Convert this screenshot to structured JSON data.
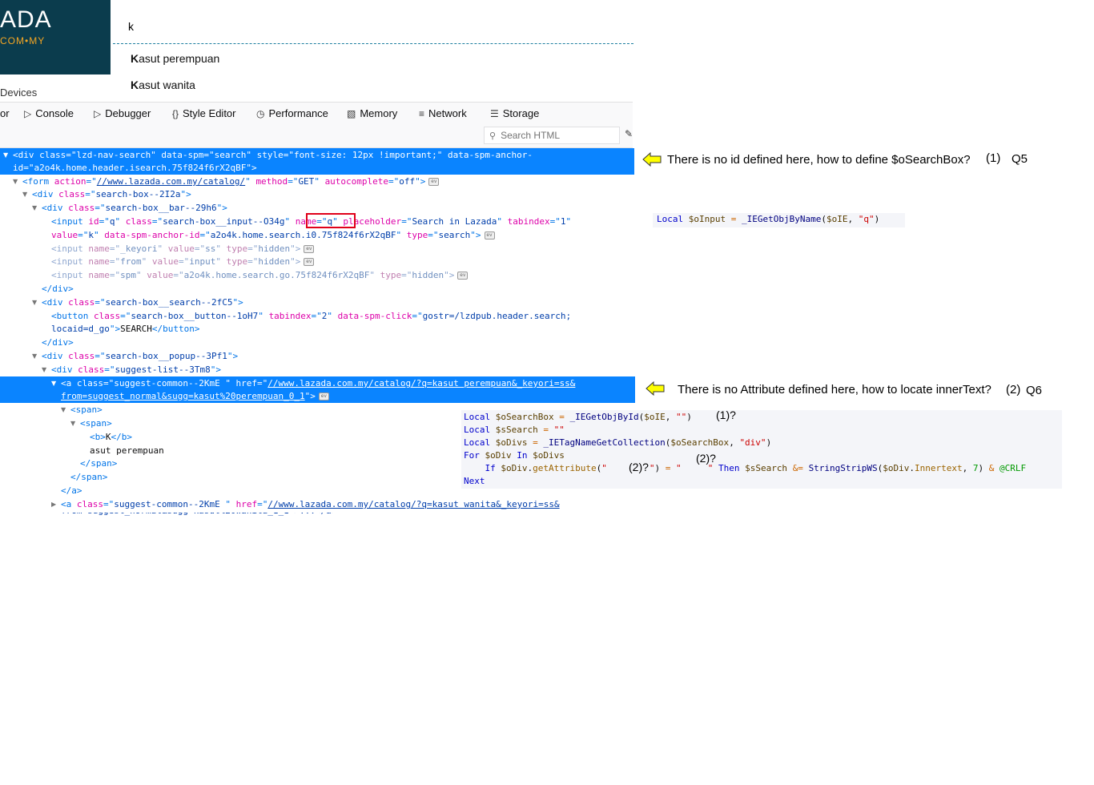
{
  "site": {
    "logo_text": "ADA",
    "logo_sub": "COM•MY",
    "devices_label": "Devices",
    "search_value": "k",
    "suggestions": [
      {
        "bold": "K",
        "rest": "asut perempuan"
      },
      {
        "bold": "K",
        "rest": "asut wanita"
      }
    ]
  },
  "devtools": {
    "tabs": [
      {
        "icon": "inspector-icon",
        "label": "or"
      },
      {
        "icon": "console-icon",
        "label": "Console"
      },
      {
        "icon": "debugger-icon",
        "label": "Debugger"
      },
      {
        "icon": "style-editor-icon",
        "label": "Style Editor"
      },
      {
        "icon": "performance-icon",
        "label": "Performance"
      },
      {
        "icon": "memory-icon",
        "label": "Memory"
      },
      {
        "icon": "network-icon",
        "label": "Network"
      },
      {
        "icon": "storage-icon",
        "label": "Storage"
      }
    ],
    "search_placeholder": "Search HTML"
  },
  "tree": {
    "l1": "<div class=\"lzd-nav-search\" data-spm=\"search\" style=\"font-size: 12px !important;\" data-spm-anchor-",
    "l2": "id=\"a2o4k.home.header.isearch.75f824f6rX2qBF\">",
    "l3_tag": "<form",
    "l3_a1": "action",
    "l3_v1": "//www.lazada.com.my/catalog/",
    "l3_a2": "method",
    "l3_v2": "GET",
    "l3_a3": "autocomplete",
    "l3_v3": "off",
    "l4_class": "search-box--2I2a",
    "l5_class": "search-box__bar--29h6",
    "l6_id": "q",
    "l6_class": "search-box__input--O34g",
    "l6_name": "q",
    "l6_placeholder": "Search in Lazada",
    "l6_tabindex": "1",
    "l7_value": "k",
    "l7_anchor": "a2o4k.home.search.i0.75f824f6rX2qBF",
    "l7_type": "search",
    "l8_name": "_keyori",
    "l8_value": "ss",
    "l8_type": "hidden",
    "l9_name": "from",
    "l9_value": "input",
    "l9_type": "hidden",
    "l10_name": "spm",
    "l10_value": "a2o4k.home.search.go.75f824f6rX2qBF",
    "l10_type": "hidden",
    "l12_class": "search-box__search--2fC5",
    "l13_class": "search-box__button--1oH7",
    "l13_tabindex": "2",
    "l13_click": "gostr=/lzdpub.header.search;",
    "l14_locaid": "locaid=d_go",
    "l14_text": "SEARCH",
    "l16_class": "search-box__popup--3Pf1",
    "l17_class": "suggest-list--3Tm8",
    "l18_class": "suggest-common--2KmE ",
    "l18_href": "//www.lazada.com.my/catalog/?q=kasut perempuan&_keyori=ss&",
    "l19_href": "from=suggest_normal&sugg=kasut%20perempuan_0_1",
    "l22_text": "K",
    "l23_text": "asut perempuan",
    "l27_href": "//www.lazada.com.my/catalog/?q=kasut wanita&_keyori=ss&"
  },
  "annotations": {
    "note1": "There is no id defined here, how to define $oSearchBox?",
    "note1_num": "(1)",
    "note1_q": "Q5",
    "note2": "There is no Attribute defined here, how to locate innerText?",
    "note2_num": "(2)",
    "note2_q": "Q6",
    "code_top": "Local $oInput = _IEGetObjByName($oIE, \"q\")",
    "ov_1": "(1)?",
    "ov_2a": "(2)?",
    "ov_2b": "(2)?"
  },
  "colors": {
    "selection": "#0a84ff",
    "logo_bg": "#0b3c4d",
    "highlight_box": "#e0001a",
    "arrow_fill": "#ffff00"
  }
}
